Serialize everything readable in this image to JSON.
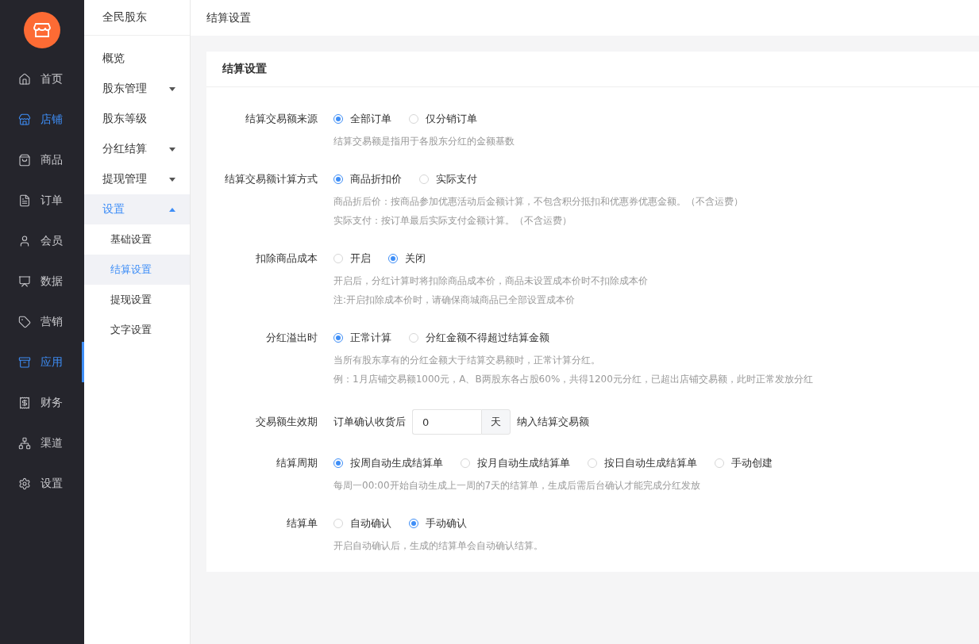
{
  "rail": {
    "items": [
      {
        "label": "首页",
        "selected": false,
        "highlighted": false
      },
      {
        "label": "店铺",
        "selected": false,
        "highlighted": true
      },
      {
        "label": "商品",
        "selected": false,
        "highlighted": false
      },
      {
        "label": "订单",
        "selected": false,
        "highlighted": false
      },
      {
        "label": "会员",
        "selected": false,
        "highlighted": false
      },
      {
        "label": "数据",
        "selected": false,
        "highlighted": false
      },
      {
        "label": "营销",
        "selected": false,
        "highlighted": false
      },
      {
        "label": "应用",
        "selected": true,
        "highlighted": true
      },
      {
        "label": "财务",
        "selected": false,
        "highlighted": false
      },
      {
        "label": "渠道",
        "selected": false,
        "highlighted": false
      },
      {
        "label": "设置",
        "selected": false,
        "highlighted": false
      }
    ]
  },
  "sidebar": {
    "title": "全民股东",
    "items": [
      {
        "label": "概览",
        "selected": false
      },
      {
        "label": "股东管理",
        "selected": false,
        "expanded": false
      },
      {
        "label": "股东等级",
        "selected": false
      },
      {
        "label": "分红结算",
        "selected": false,
        "expanded": false
      },
      {
        "label": "提现管理",
        "selected": false,
        "expanded": false
      },
      {
        "label": "设置",
        "selected": true,
        "expanded": true,
        "children": [
          {
            "label": "基础设置",
            "selected": false
          },
          {
            "label": "结算设置",
            "selected": true
          },
          {
            "label": "提现设置",
            "selected": false
          },
          {
            "label": "文字设置",
            "selected": false
          }
        ]
      }
    ]
  },
  "header": {
    "title": "结算设置"
  },
  "card": {
    "title": "结算设置",
    "rows": [
      {
        "kind": "radio",
        "label": "结算交易额来源",
        "options": [
          {
            "label": "全部订单",
            "selected": true
          },
          {
            "label": "仅分销订单",
            "selected": false
          }
        ],
        "hints": [
          "结算交易额是指用于各股东分红的金额基数"
        ]
      },
      {
        "kind": "radio",
        "label": "结算交易额计算方式",
        "options": [
          {
            "label": "商品折扣价",
            "selected": true
          },
          {
            "label": "实际支付",
            "selected": false
          }
        ],
        "hints": [
          "商品折后价：按商品参加优惠活动后金额计算，不包含积分抵扣和优惠券优惠金额。（不含运费）",
          "实际支付：按订单最后实际支付金额计算。（不含运费）"
        ]
      },
      {
        "kind": "radio",
        "label": "扣除商品成本",
        "options": [
          {
            "label": "开启",
            "selected": false
          },
          {
            "label": "关闭",
            "selected": true
          }
        ],
        "hints": [
          "开启后，分红计算时将扣除商品成本价，商品未设置成本价时不扣除成本价",
          "注:开启扣除成本价时，请确保商城商品已全部设置成本价"
        ]
      },
      {
        "kind": "radio",
        "label": "分红溢出时",
        "options": [
          {
            "label": "正常计算",
            "selected": true
          },
          {
            "label": "分红金额不得超过结算金额",
            "selected": false
          }
        ],
        "hints": [
          "当所有股东享有的分红金额大于结算交易额时，正常计算分红。",
          "例：1月店铺交易额1000元，A、B两股东各占股60%，共得1200元分红，已超出店铺交易额，此时正常发放分红"
        ]
      },
      {
        "kind": "input",
        "label": "交易额生效期",
        "prefix": "订单确认收货后",
        "value": "0",
        "unit": "天",
        "suffix": "纳入结算交易额"
      },
      {
        "kind": "radio",
        "label": "结算周期",
        "options": [
          {
            "label": "按周自动生成结算单",
            "selected": true
          },
          {
            "label": "按月自动生成结算单",
            "selected": false
          },
          {
            "label": "按日自动生成结算单",
            "selected": false
          },
          {
            "label": "手动创建",
            "selected": false
          }
        ],
        "hints": [
          "每周一00:00开始自动生成上一周的7天的结算单，生成后需后台确认才能完成分红发放"
        ]
      },
      {
        "kind": "radio",
        "label": "结算单",
        "options": [
          {
            "label": "自动确认",
            "selected": false
          },
          {
            "label": "手动确认",
            "selected": true
          }
        ],
        "hints": [
          "开启自动确认后，生成的结算单会自动确认结算。"
        ]
      }
    ]
  }
}
